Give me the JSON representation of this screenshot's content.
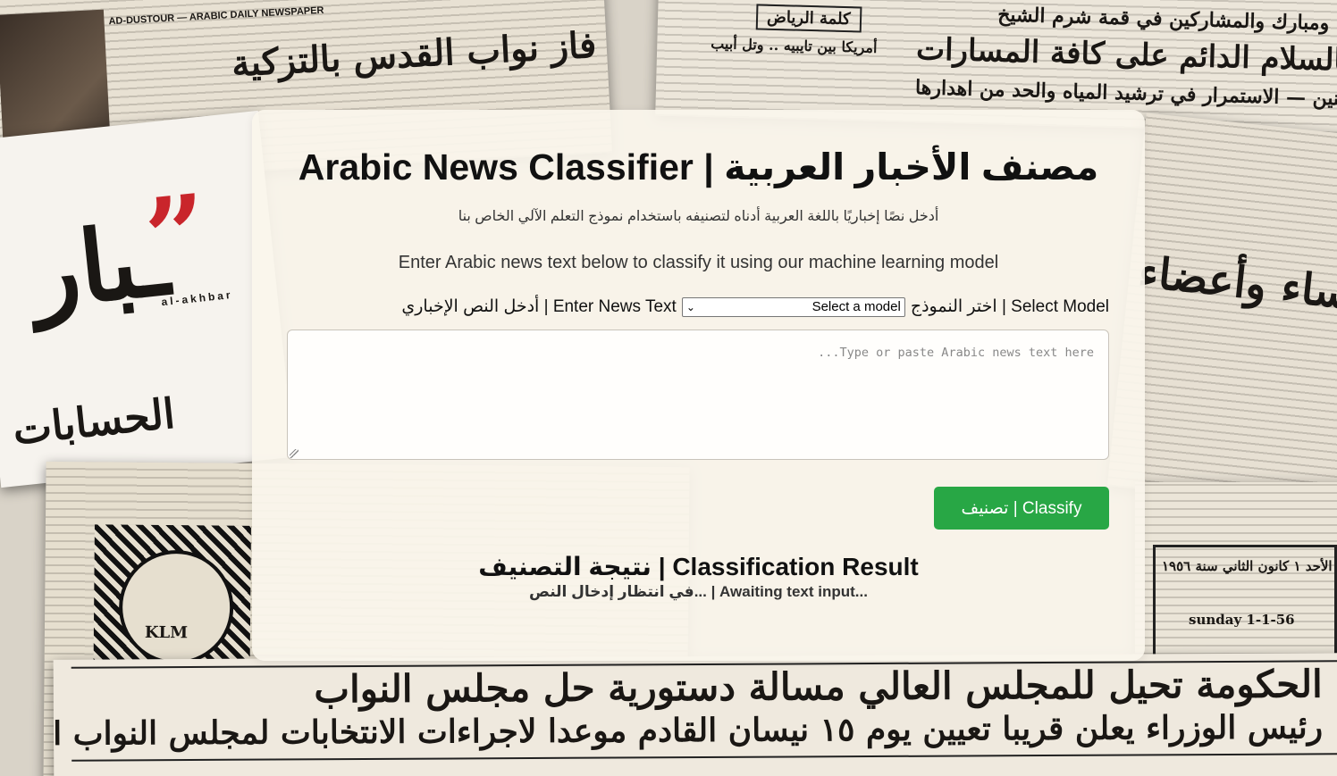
{
  "app": {
    "title": "Arabic News Classifier | مصنف الأخبار العربية",
    "description_ar": "أدخل نصًا إخباريًا باللغة العربية أدناه لتصنيفه باستخدام نموذج التعلم الآلي الخاص بنا",
    "description_en": "Enter Arabic news text below to classify it using our machine learning model"
  },
  "form": {
    "model_label": "اختر النموذج | Select Model",
    "model_select": {
      "selected": "Select a model"
    },
    "text_label": "أدخل النص الإخباري | Enter News Text",
    "textarea_placeholder": "...Type or paste Arabic news text here",
    "classify_button": "تصنيف | Classify"
  },
  "result": {
    "title": "نتيجة التصنيف | Classification Result",
    "status": "في انتظار إدخال النص... | Awaiting text input..."
  },
  "background": {
    "headlines": [
      "فاز نواب القدس بالتزكية",
      "كلمة الرياض",
      "أمريكا بين تايبيه .. وتل أبيب",
      "كلينتون ومبارك والمشاركين في قمة شرم الشيخ",
      "إلتزام المملكة بالسلام الدائم على كافة المسارات",
      "طموحات المواطنين — الاستمرار في ترشيد المياه والحد من اهدارها",
      "رؤساء وأعضاء",
      "الحسابات",
      "الأحد ١ كانون الثاني سنة ١٩٥٦",
      "sunday 1-1-56",
      "الحكومة تحيل للمجلس العالي مسالة دستورية حل مجلس النواب",
      "رئيس الوزراء يعلن قريبا تعيين يوم ١٥ نيسان القادم موعدا لاجراءات الانتخابات لمجلس النواب الجديد",
      "AD-DUSTOUR — ARABIC DAILY NEWSPAPER",
      "al-akhbar",
      "KLM"
    ]
  }
}
